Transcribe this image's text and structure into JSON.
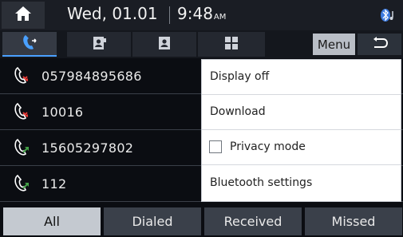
{
  "status_bar": {
    "date": "Wed, 01.01",
    "time": "9:48",
    "ampm": "AM"
  },
  "tabs": [
    {
      "icon": "recent-calls-icon",
      "active": true
    },
    {
      "icon": "contacts-icon",
      "active": false
    },
    {
      "icon": "phonebook-icon",
      "active": false
    },
    {
      "icon": "keypad-icon",
      "active": false
    }
  ],
  "toolbar": {
    "menu_label": "Menu",
    "back_icon": "back-arrow-icon"
  },
  "calls": [
    {
      "number": "057984895686",
      "type": "missed",
      "icon": "missed-call-icon"
    },
    {
      "number": "10016",
      "type": "missed",
      "icon": "missed-call-icon"
    },
    {
      "number": "15605297802",
      "type": "outgoing",
      "icon": "outgoing-call-icon"
    },
    {
      "number": "112",
      "type": "outgoing",
      "icon": "outgoing-call-icon"
    }
  ],
  "menu": {
    "items": [
      {
        "label": "Display off"
      },
      {
        "label": "Download"
      },
      {
        "label": "Privacy mode",
        "checkbox": true,
        "checked": false
      },
      {
        "label": "Bluetooth settings"
      }
    ]
  },
  "filters": [
    {
      "label": "All",
      "active": true
    },
    {
      "label": "Dialed",
      "active": false
    },
    {
      "label": "Received",
      "active": false
    },
    {
      "label": "Missed",
      "active": false
    }
  ],
  "colors": {
    "background": "#0b0d12",
    "missed_red": "#e53935",
    "outgoing_green": "#43a047",
    "accent_blue": "#4aa0ff",
    "active_filter": "#c4c9d0"
  }
}
